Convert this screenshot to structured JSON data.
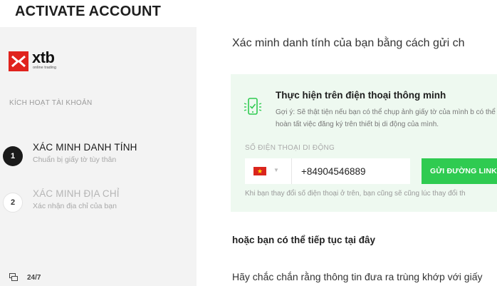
{
  "header": {
    "title": "ACTIVATE ACCOUNT"
  },
  "sidebar": {
    "logo": {
      "text": "xtb",
      "tagline": "online trading"
    },
    "section_label": "KÍCH HOẠT TÀI KHOẢN",
    "steps": [
      {
        "number": "1",
        "title": "XÁC MINH DANH TÍNH",
        "subtitle": "Chuẩn bị giấy tờ tùy thân",
        "active": true
      },
      {
        "number": "2",
        "title": "XÁC MINH ĐỊA CHỈ",
        "subtitle": "Xác nhận địa chỉ của bạn",
        "active": false
      }
    ],
    "support": {
      "icon": "chat-icon",
      "label": "24/7"
    }
  },
  "main": {
    "intro": "Xác minh danh tính của bạn bằng cách gửi ch",
    "card": {
      "icon": "smartphone-check-icon",
      "title": "Thực hiện trên điện thoại thông minh",
      "tip": "Gợi ý: Sẽ thật tiện nếu bạn có thể chụp ảnh giấy tờ của mình b có thể hoàn tất việc đăng ký trên thiết bị di động của mình.",
      "phone_label": "SỐ ĐIỆN THOẠI DI ĐỘNG",
      "country_flag": "vietnam-flag-icon",
      "phone_value": "+84904546889",
      "send_button": "GỬI ĐƯỜNG LINK",
      "note": "Khi bạn thay đổi số điện thoại ở trên, bạn cũng sẽ cũng lúc thay đổi th"
    },
    "alt_heading": "hoặc bạn có thể tiếp tục tại đây",
    "bottom_text": "Hãy chắc chắn rằng thông tin đưa ra trùng khớp với giấy"
  },
  "colors": {
    "brand_red": "#e0231d",
    "accent_green": "#2fcb51",
    "card_bg": "#eef9f0",
    "sidebar_bg": "#f3f3f3"
  }
}
